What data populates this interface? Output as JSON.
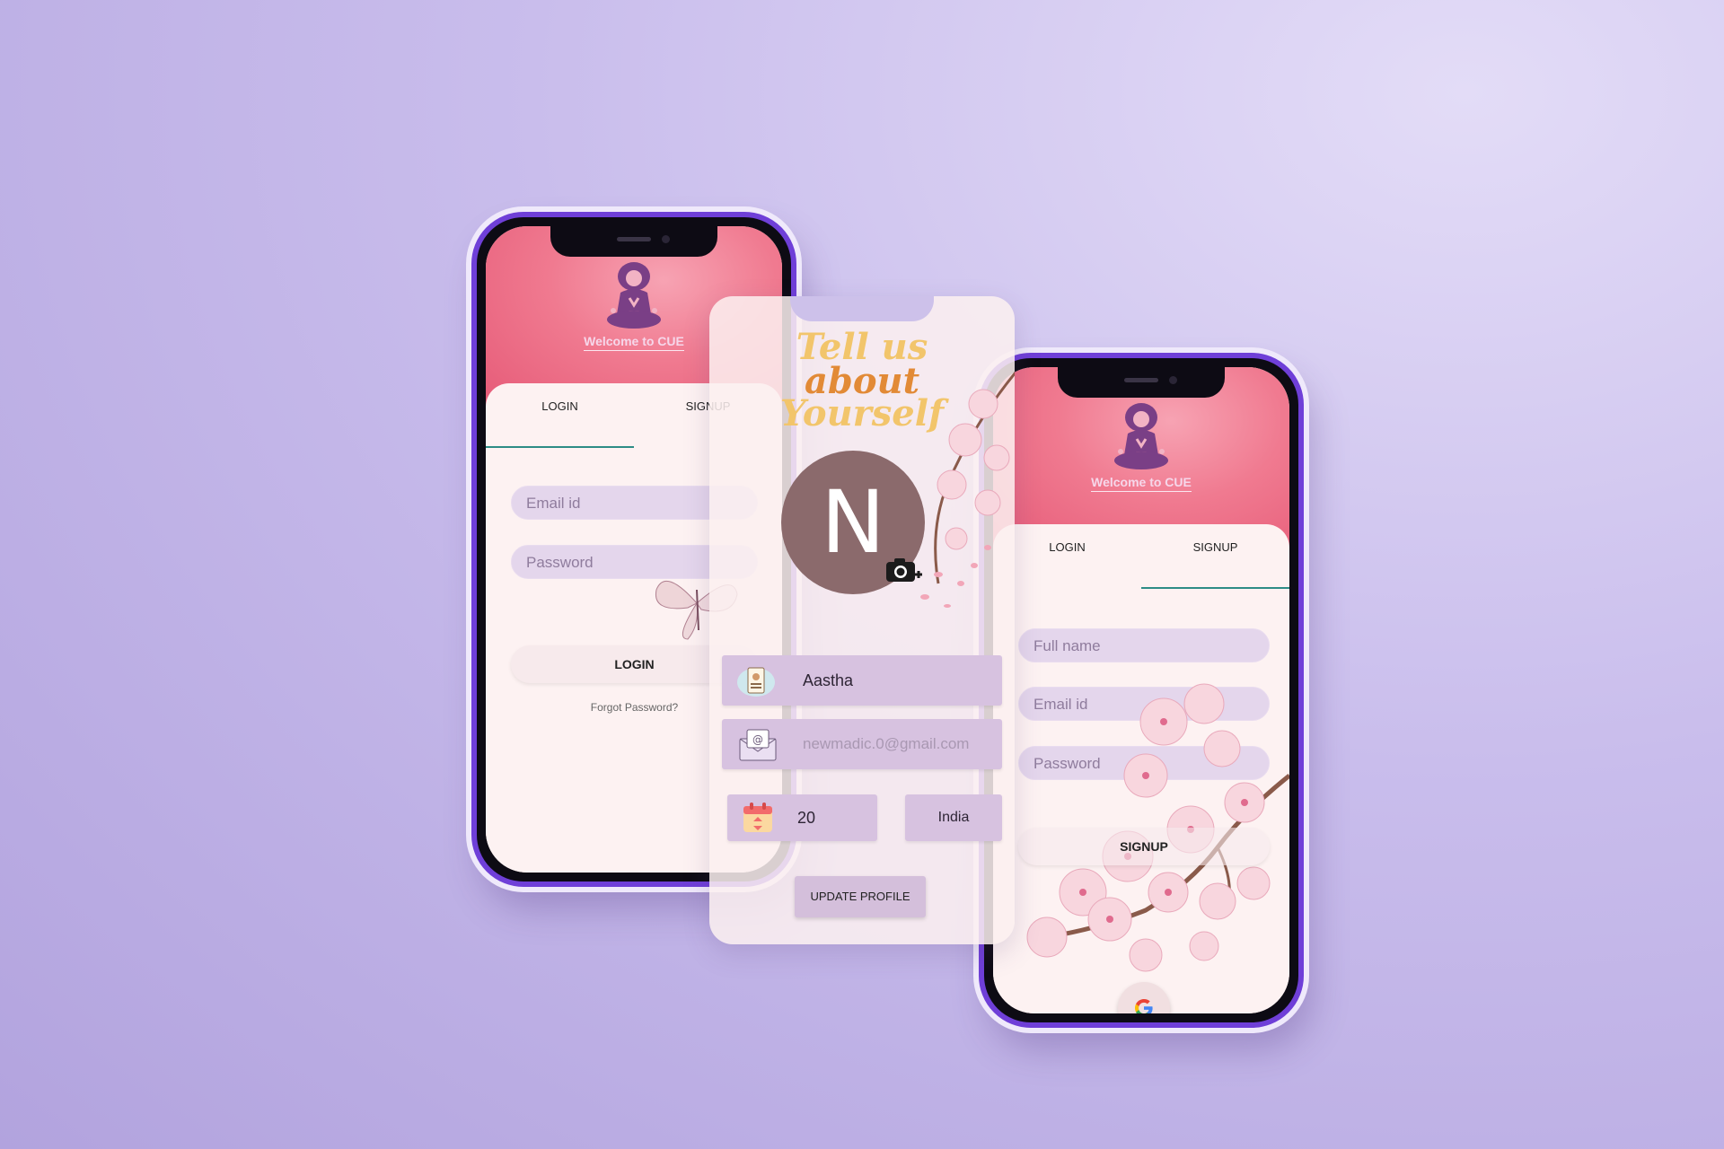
{
  "login_phone": {
    "welcome": "Welcome to CUE",
    "tabs": [
      "LOGIN",
      "SIGNUP"
    ],
    "email_placeholder": "Email id",
    "password_placeholder": "Password",
    "login_button": "LOGIN",
    "forgot_password": "Forgot Password?"
  },
  "profile_card": {
    "headline": [
      "Tell us",
      "about",
      "Yourself"
    ],
    "avatar_initial": "N",
    "name": "Aastha",
    "email": "newmadic.0@gmail.com",
    "age": "20",
    "country": "India",
    "update_button": "UPDATE PROFILE"
  },
  "signup_phone": {
    "welcome": "Welcome to CUE",
    "tabs": [
      "LOGIN",
      "SIGNUP"
    ],
    "fullname_placeholder": "Full name",
    "email_placeholder": "Email id",
    "password_placeholder": "Password",
    "signup_button": "SIGNUP"
  },
  "colors": {
    "background": "#c3b6ea",
    "phone_frame": "#6f3fd8",
    "hero_pink": "#f07a90",
    "field_lilac": "#e4d6ec",
    "tab_underline": "#2d8c86",
    "headline_gold": "#f2c56b",
    "headline_orange": "#e28a36",
    "avatar_brown": "#8b6a6c"
  },
  "icons": [
    "meditating-woman-logo",
    "google-icon",
    "camera-add-icon",
    "id-card-icon",
    "email-envelope-icon",
    "calendar-icon",
    "cherry-blossom",
    "butterfly"
  ]
}
